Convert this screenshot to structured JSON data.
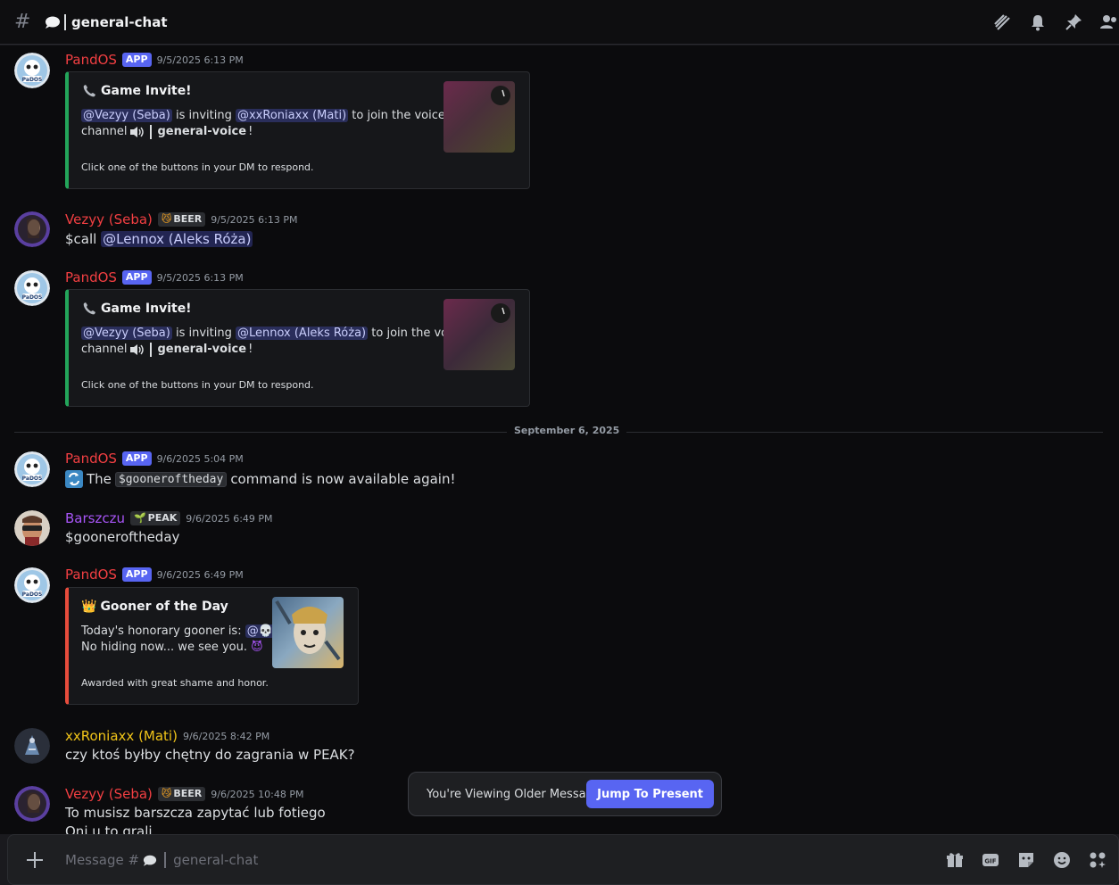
{
  "channel": {
    "name": "general-chat"
  },
  "colors": {
    "pandos": "#f23f42",
    "vezyy": "#f23f42",
    "barszczu": "#a855f7",
    "xxroniaxx": "#f0c419",
    "accent": "#5865f2"
  },
  "messages": [
    {
      "author": "PandOS",
      "badge": "APP",
      "time": "9/5/2025 6:13 PM",
      "embed": {
        "title": "Game Invite!",
        "mention1": "@Vezyy (Seba)",
        "text1": " is inviting ",
        "mention2": "@xxRoniaxx (Mati)",
        "text2": " to join the voice",
        "line2a": "channel",
        "line2b": "general-voice",
        "line2c": "!",
        "footer": "Click one of the buttons in your DM to respond."
      }
    },
    {
      "author": "Vezyy (Seba)",
      "badge": "BEER",
      "time": "9/5/2025 6:13 PM",
      "text": "$call",
      "mention": "@Lennox (Aleks Róża)"
    },
    {
      "author": "PandOS",
      "badge": "APP",
      "time": "9/5/2025 6:13 PM",
      "embed": {
        "title": "Game Invite!",
        "mention1": "@Vezyy (Seba)",
        "text1": " is inviting ",
        "mention2": "@Lennox (Aleks Róża)",
        "text2": " to join the voice",
        "line2a": "channel",
        "line2b": "general-voice",
        "line2c": "!",
        "footer": "Click one of the buttons in your DM to respond."
      }
    },
    {
      "author": "PandOS",
      "badge": "APP",
      "time": "9/6/2025 5:04 PM",
      "text_a": "The",
      "code": "$gooneroftheday",
      "text_b": "command is now available again!"
    },
    {
      "author": "Barszczu",
      "badge": "PEAK",
      "time": "9/6/2025 6:49 PM",
      "text": "$gooneroftheday"
    },
    {
      "author": "PandOS",
      "badge": "APP",
      "time": "9/6/2025 6:49 PM",
      "embed": {
        "title": "Gooner of the Day",
        "line1": "Today's honorary gooner is:",
        "mention": "@",
        "line2": "No hiding now... we see you.",
        "footer": "Awarded with great shame and honor."
      }
    },
    {
      "author": "xxRoniaxx (Mati)",
      "time": "9/6/2025 8:42 PM",
      "text": "czy ktoś byłby chętny do zagrania w PEAK?"
    },
    {
      "author": "Vezyy (Seba)",
      "badge": "BEER",
      "time": "9/6/2025 10:48 PM",
      "text": "To musisz barszcza zapytać lub fotiego",
      "text2": "Oni u to grali"
    }
  ],
  "divider": "September 6, 2025",
  "older_banner": {
    "text": "You're Viewing Older Messages",
    "button": "Jump To Present"
  },
  "composer": {
    "placeholder_prefix": "Message #",
    "placeholder_channel": "general-chat"
  },
  "icons": {
    "header": [
      "threads-icon",
      "bell-icon",
      "pin-icon",
      "members-icon"
    ],
    "composer": [
      "gift-icon",
      "gif-icon",
      "sticker-icon",
      "emoji-icon",
      "apps-icon"
    ]
  }
}
